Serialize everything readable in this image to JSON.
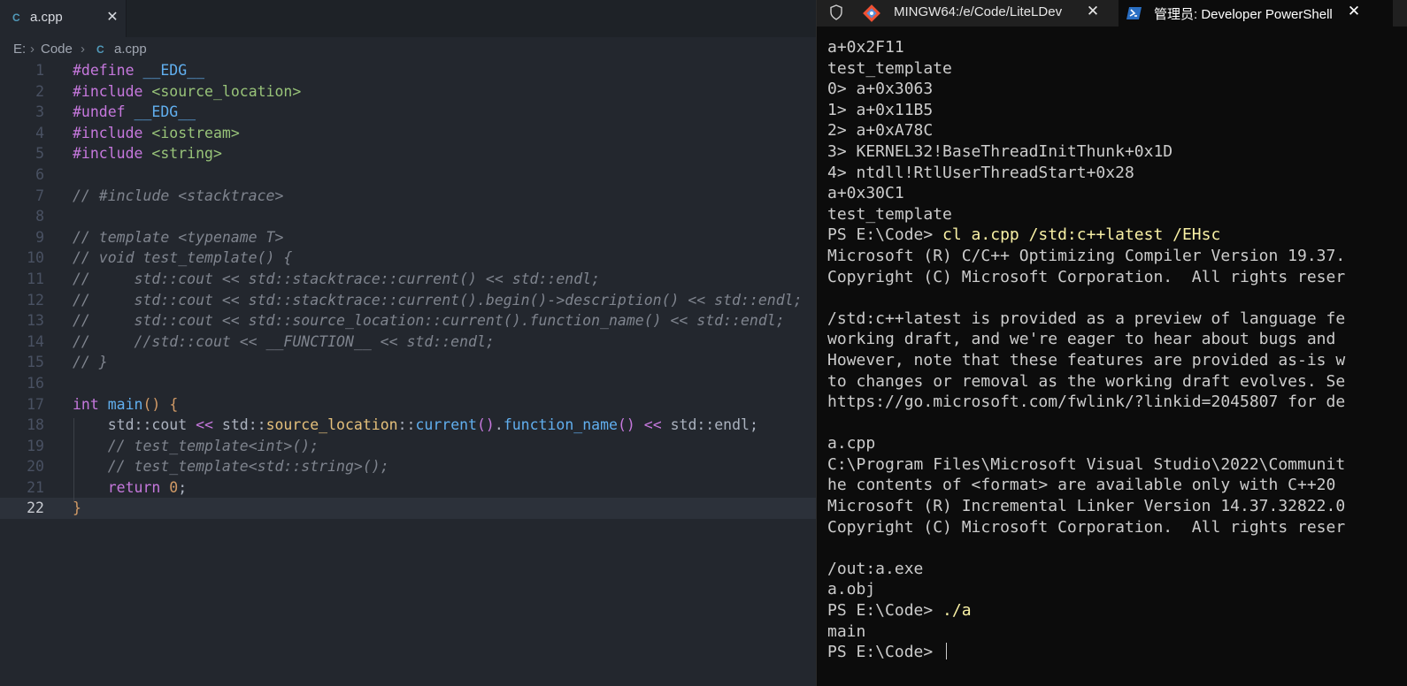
{
  "editor": {
    "tab": {
      "label": "a.cpp",
      "close": "✕"
    },
    "breadcrumb": {
      "drive": "E:",
      "folder": "Code",
      "file": "a.cpp",
      "separator": "›"
    },
    "lines": [
      {
        "n": "1",
        "html": "<span class='kw'>#define</span> <span class='mac'>__EDG__</span>"
      },
      {
        "n": "2",
        "html": "<span class='kw'>#include</span> <span class='inc'>&lt;source_location&gt;</span>"
      },
      {
        "n": "3",
        "html": "<span class='kw'>#undef</span> <span class='mac'>__EDG__</span>"
      },
      {
        "n": "4",
        "html": "<span class='kw'>#include</span> <span class='inc'>&lt;iostream&gt;</span>"
      },
      {
        "n": "5",
        "html": "<span class='kw'>#include</span> <span class='inc'>&lt;string&gt;</span>"
      },
      {
        "n": "6",
        "html": ""
      },
      {
        "n": "7",
        "html": "<span class='cm'>// #include &lt;stacktrace&gt;</span>"
      },
      {
        "n": "8",
        "html": ""
      },
      {
        "n": "9",
        "html": "<span class='cm'>// template &lt;typename T&gt;</span>"
      },
      {
        "n": "10",
        "html": "<span class='cm'>// void test_template() {</span>"
      },
      {
        "n": "11",
        "html": "<span class='cm'>//     std::cout &lt;&lt; std::stacktrace::current() &lt;&lt; std::endl;</span>"
      },
      {
        "n": "12",
        "html": "<span class='cm'>//     std::cout &lt;&lt; std::stacktrace::current().begin()-&gt;description() &lt;&lt; std::endl;</span>"
      },
      {
        "n": "13",
        "html": "<span class='cm'>//     std::cout &lt;&lt; std::source_location::current().function_name() &lt;&lt; std::endl;</span>"
      },
      {
        "n": "14",
        "html": "<span class='cm'>//     //std::cout &lt;&lt; __FUNCTION__ &lt;&lt; std::endl;</span>"
      },
      {
        "n": "15",
        "html": "<span class='cm'>// }</span>"
      },
      {
        "n": "16",
        "html": ""
      },
      {
        "n": "17",
        "html": "<span class='kw'>int</span> <span class='fn'>main</span><span class='br'>()</span> <span class='br'>{</span>"
      },
      {
        "n": "18",
        "html": "    std::cout <span class='op'>&lt;&lt;</span> std::<span class='ty'>source_location</span>::<span class='fn'>current</span><span class='op'>()</span>.<span class='fn'>function_name</span><span class='op'>()</span> <span class='op'>&lt;&lt;</span> std::endl;"
      },
      {
        "n": "19",
        "html": "    <span class='cm'>// test_template&lt;int&gt;();</span>"
      },
      {
        "n": "20",
        "html": "    <span class='cm'>// test_template&lt;std::string&gt;();</span>"
      },
      {
        "n": "21",
        "html": "    <span class='kw'>return</span> <span class='num'>0</span>;"
      },
      {
        "n": "22",
        "html": "<span class='br'>}</span>"
      }
    ]
  },
  "terminal": {
    "tabs": [
      {
        "label": "MINGW64:/e/Code/LiteLDev",
        "close": "✕"
      },
      {
        "label": "管理员: Developer PowerShell",
        "close": "✕"
      }
    ],
    "lines": [
      {
        "text": "a+0x2F11"
      },
      {
        "text": "test_template"
      },
      {
        "text": "0> a+0x3063"
      },
      {
        "text": "1> a+0x11B5"
      },
      {
        "text": "2> a+0xA78C"
      },
      {
        "text": "3> KERNEL32!BaseThreadInitThunk+0x1D"
      },
      {
        "text": "4> ntdll!RtlUserThreadStart+0x28"
      },
      {
        "text": "a+0x30C1"
      },
      {
        "text": "test_template"
      },
      {
        "prompt": "PS E:\\Code> ",
        "cmd": "cl a.cpp /std:c++latest /EHsc"
      },
      {
        "text": "Microsoft (R) C/C++ Optimizing Compiler Version 19.37."
      },
      {
        "text": "Copyright (C) Microsoft Corporation.  All rights reser"
      },
      {
        "text": ""
      },
      {
        "text": "/std:c++latest is provided as a preview of language fe"
      },
      {
        "text": "working draft, and we're eager to hear about bugs and"
      },
      {
        "text": "However, note that these features are provided as-is w"
      },
      {
        "text": "to changes or removal as the working draft evolves. Se"
      },
      {
        "text": "https://go.microsoft.com/fwlink/?linkid=2045807 for de"
      },
      {
        "text": ""
      },
      {
        "text": "a.cpp"
      },
      {
        "text": "C:\\Program Files\\Microsoft Visual Studio\\2022\\Communit"
      },
      {
        "text": "he contents of <format> are available only with C++20"
      },
      {
        "text": "Microsoft (R) Incremental Linker Version 14.37.32822.0"
      },
      {
        "text": "Copyright (C) Microsoft Corporation.  All rights reser"
      },
      {
        "text": ""
      },
      {
        "text": "/out:a.exe"
      },
      {
        "text": "a.obj"
      },
      {
        "prompt": "PS E:\\Code> ",
        "cmd": "./a"
      },
      {
        "text": "main"
      },
      {
        "prompt": "PS E:\\Code> ",
        "cmd": "",
        "cursor": true
      }
    ]
  }
}
